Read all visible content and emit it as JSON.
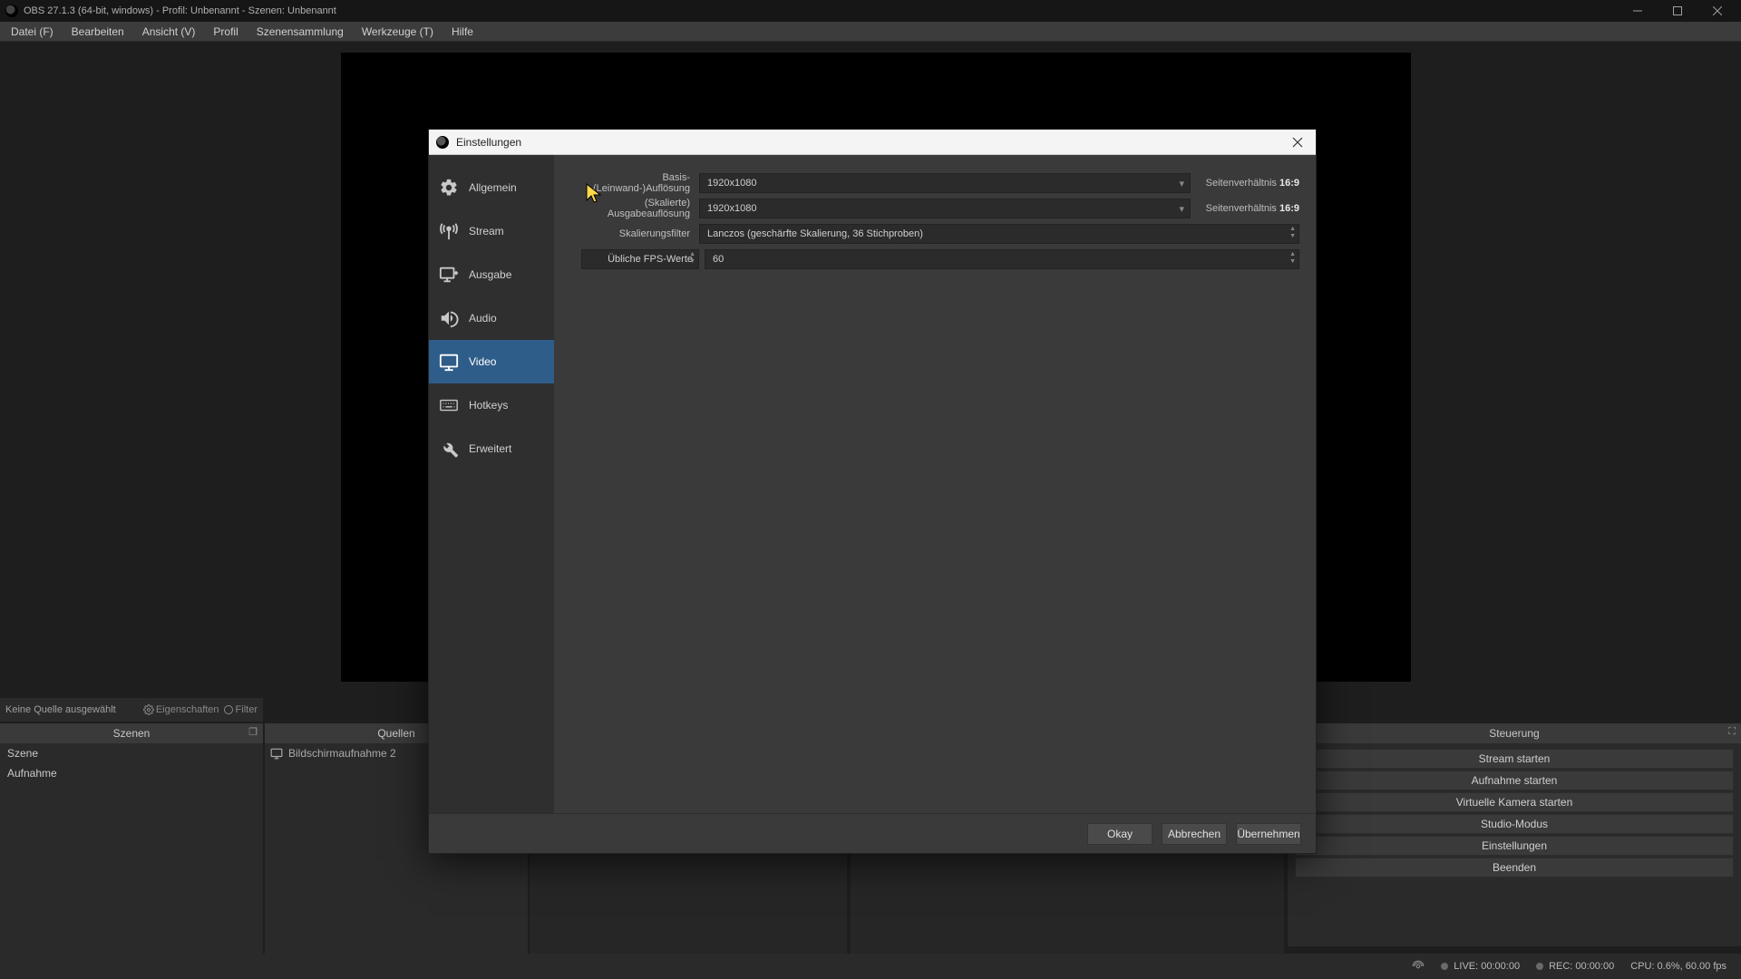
{
  "window": {
    "title": "OBS 27.1.3 (64-bit, windows) - Profil: Unbenannt - Szenen: Unbenannt"
  },
  "menu": {
    "items": [
      "Datei (F)",
      "Bearbeiten",
      "Ansicht (V)",
      "Profil",
      "Szenensammlung",
      "Werkzeuge (T)",
      "Hilfe"
    ]
  },
  "info_bar": {
    "no_source": "Keine Quelle ausgewählt",
    "properties": "Eigenschaften",
    "filter": "Filter"
  },
  "docks": {
    "scenes": {
      "title": "Szenen",
      "items": [
        "Szene",
        "Aufnahme"
      ]
    },
    "sources": {
      "title": "Quellen",
      "items": [
        "Bildschirmaufnahme 2"
      ]
    },
    "controls": {
      "title": "Steuerung",
      "buttons": [
        "Stream starten",
        "Aufnahme starten",
        "Virtuelle Kamera starten",
        "Studio-Modus",
        "Einstellungen",
        "Beenden"
      ]
    }
  },
  "status": {
    "live": "LIVE: 00:00:00",
    "rec": "REC: 00:00:00",
    "cpu": "CPU: 0.6%, 60.00 fps"
  },
  "settings": {
    "title": "Einstellungen",
    "nav": {
      "allgemein": "Allgemein",
      "stream": "Stream",
      "ausgabe": "Ausgabe",
      "audio": "Audio",
      "video": "Video",
      "hotkeys": "Hotkeys",
      "erweitert": "Erweitert"
    },
    "video": {
      "base_label": "Basis-(Leinwand-)Auflösung",
      "base_value": "1920x1080",
      "base_aspect_label": "Seitenverhältnis",
      "base_aspect_value": "16:9",
      "output_label": "(Skalierte) Ausgabeauflösung",
      "output_value": "1920x1080",
      "output_aspect_label": "Seitenverhältnis",
      "output_aspect_value": "16:9",
      "filter_label": "Skalierungsfilter",
      "filter_value": "Lanczos (geschärfte Skalierung, 36 Stichproben)",
      "fps_label": "Übliche FPS-Werte",
      "fps_value": "60"
    },
    "buttons": {
      "ok": "Okay",
      "cancel": "Abbrechen",
      "apply": "Übernehmen"
    }
  }
}
